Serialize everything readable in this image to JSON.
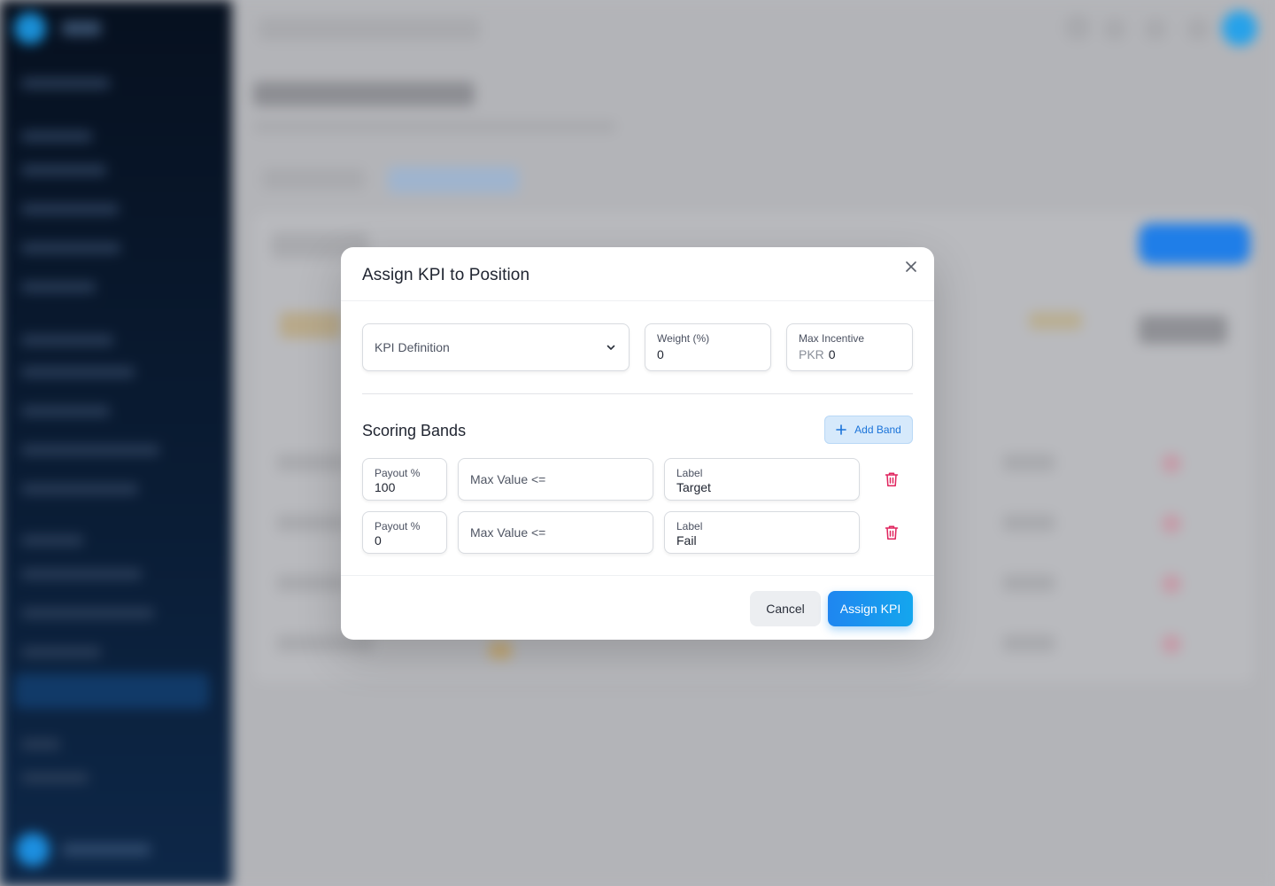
{
  "modal": {
    "title": "Assign KPI to Position",
    "kpi_definition": {
      "placeholder": "KPI Definition"
    },
    "weight": {
      "label": "Weight (%)",
      "value": "0"
    },
    "max_incentive": {
      "label": "Max Incentive",
      "prefix": "PKR",
      "value": "0"
    },
    "scoring_bands": {
      "title": "Scoring Bands",
      "add_label": "Add Band",
      "bands": [
        {
          "payout_label": "Payout %",
          "payout": "100",
          "max_placeholder": "Max Value <=",
          "label_label": "Label",
          "label": "Target"
        },
        {
          "payout_label": "Payout %",
          "payout": "0",
          "max_placeholder": "Max Value <=",
          "label_label": "Label",
          "label": "Fail"
        }
      ]
    },
    "cancel_label": "Cancel",
    "assign_label": "Assign KPI"
  },
  "colors": {
    "accent": "#1f86f0",
    "danger": "#e0245e",
    "overlay": "#b6b7bb"
  },
  "icons": {
    "close": "close-icon",
    "chevron": "chevron-down-icon",
    "add": "plus-icon",
    "delete": "trash-icon"
  }
}
